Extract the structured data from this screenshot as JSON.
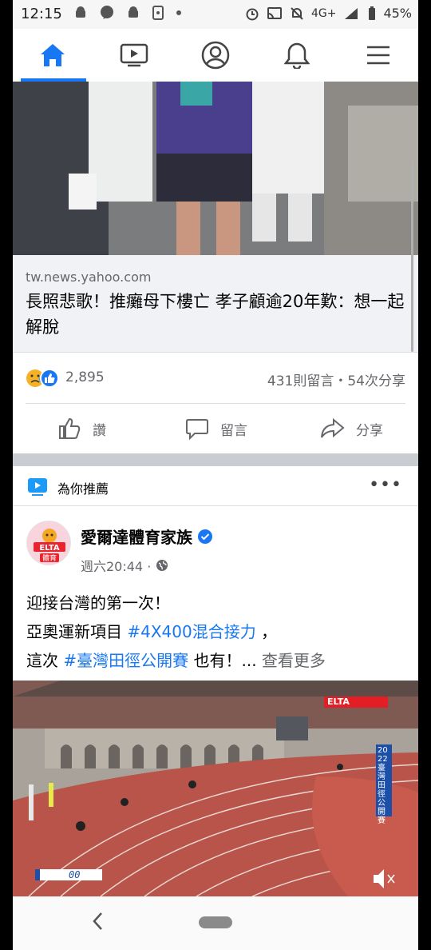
{
  "status_bar": {
    "time": "12:15",
    "network": "4G+",
    "battery": "45%",
    "left_icons": [
      "android-icon",
      "messenger-icon",
      "android-icon",
      "file-icon",
      "dot-icon"
    ],
    "right_icons": [
      "alarm-icon",
      "cast-icon",
      "mute-icon",
      "signal-icon",
      "battery-icon"
    ]
  },
  "top_nav": {
    "tabs": [
      {
        "name": "home",
        "icon": "home-icon",
        "active": true
      },
      {
        "name": "watch",
        "icon": "video-icon",
        "active": false
      },
      {
        "name": "profile",
        "icon": "profile-icon",
        "active": false
      },
      {
        "name": "notifications",
        "icon": "bell-icon",
        "active": false
      },
      {
        "name": "menu",
        "icon": "hamburger-icon",
        "active": false
      }
    ],
    "accent_color": "#1877f2"
  },
  "post1": {
    "link_domain": "tw.news.yahoo.com",
    "link_title": "長照悲歌！推癱母下樓亡 孝子顧逾20年歎：想一起解脫",
    "reactions_count": "2,895",
    "stats": "431則留言・54次分享",
    "reaction_icons": [
      "sad-icon",
      "like-icon"
    ],
    "actions": {
      "like": "讚",
      "comment": "留言",
      "share": "分享"
    }
  },
  "recommended": {
    "label": "為你推薦",
    "more": "•••"
  },
  "post2": {
    "page_name": "愛爾達體育家族",
    "verified": true,
    "timestamp": "週六20:44 ·",
    "text_line1": "迎接台灣的第一次！",
    "text_line2_prefix": "亞奧運新項目 ",
    "hashtag1": "#4X400混合接力",
    "text_line2_suffix": " ，",
    "text_line3_prefix": "這次 ",
    "hashtag2": "#臺灣田徑公開賽",
    "text_line3_suffix": " 也有！... ",
    "see_more": "查看更多",
    "video_overlay": {
      "timer": "00",
      "side_banner": "2022臺灣田徑公開賽",
      "brand_label": "ELTA"
    }
  },
  "system_nav": {
    "back": "‹"
  }
}
